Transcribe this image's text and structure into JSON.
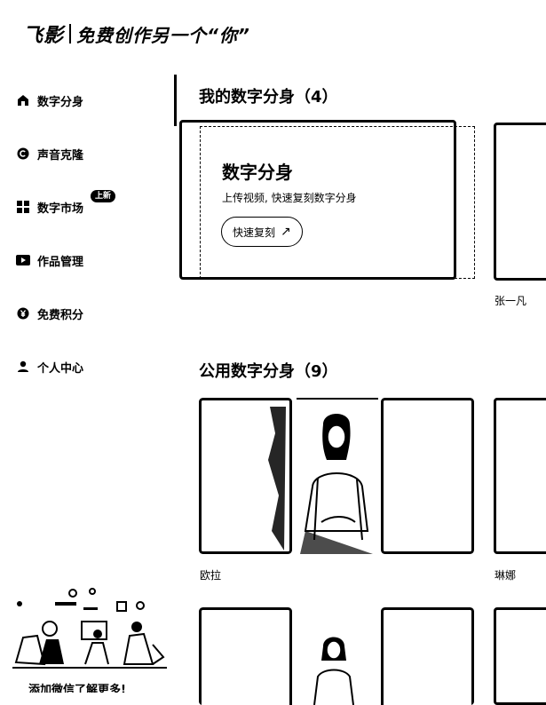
{
  "header": {
    "logo": "飞影",
    "slogan": "免费创作另一个“你”"
  },
  "sidebar": {
    "items": [
      {
        "label": "数字分身",
        "icon": "home-icon"
      },
      {
        "label": "声音克隆",
        "icon": "copyright-icon"
      },
      {
        "label": "数字市场",
        "icon": "grid-icon"
      },
      {
        "label": "作品管理",
        "icon": "play-icon"
      },
      {
        "label": "免费积分",
        "icon": "yen-icon"
      },
      {
        "label": "个人中心",
        "icon": "user-icon"
      }
    ],
    "badge": "上新",
    "promo_text": "添加微信了解更多!"
  },
  "my_section": {
    "title": "我的数字分身（4）",
    "create_card": {
      "title": "数字分身",
      "desc": "上传视频, 快速复刻数字分身",
      "button": "快速复刻",
      "button_icon": "arrow-up-right-icon"
    },
    "avatars": [
      {
        "name": "张一凡"
      }
    ]
  },
  "public_section": {
    "title": "公用数字分身（9）",
    "avatars": [
      {
        "name": "欧拉"
      },
      {
        "name": "琳娜"
      }
    ]
  }
}
